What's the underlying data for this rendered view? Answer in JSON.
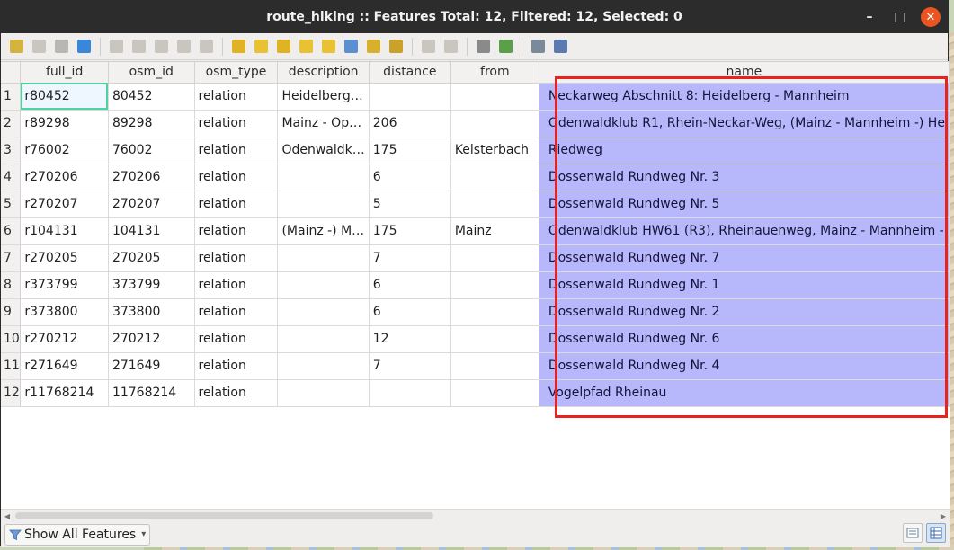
{
  "window": {
    "title": "route_hiking :: Features Total: 12, Filtered: 12, Selected: 0",
    "minimize_glyph": "–",
    "maximize_glyph": "□",
    "close_glyph": "✕"
  },
  "toolbar": {
    "icons": [
      {
        "name": "toggle-editing-icon",
        "color": "#d4b43c"
      },
      {
        "name": "multi-edit-icon",
        "color": "#c9c6bf"
      },
      {
        "name": "save-edits-icon",
        "color": "#b9b7b3"
      },
      {
        "name": "reload-icon",
        "color": "#3a86d8"
      },
      {
        "name": "add-feature-icon",
        "color": "#c9c6bf"
      },
      {
        "name": "delete-feature-icon",
        "color": "#c9c6bf"
      },
      {
        "name": "cut-icon",
        "color": "#c9c6bf"
      },
      {
        "name": "copy-icon",
        "color": "#c9c6bf"
      },
      {
        "name": "paste-icon",
        "color": "#c9c6bf"
      },
      {
        "name": "select-by-expression-icon",
        "color": "#e0b325"
      },
      {
        "name": "select-all-icon",
        "color": "#e8c233"
      },
      {
        "name": "invert-selection-icon",
        "color": "#e0b325"
      },
      {
        "name": "deselect-all-icon",
        "color": "#e8c233"
      },
      {
        "name": "filter-select-icon",
        "color": "#e8c233"
      },
      {
        "name": "move-selection-top-icon",
        "color": "#5a8fd0"
      },
      {
        "name": "pan-to-selected-icon",
        "color": "#d8b02c"
      },
      {
        "name": "zoom-to-selected-icon",
        "color": "#c9a22a"
      },
      {
        "name": "new-field-icon",
        "color": "#c9c6bf"
      },
      {
        "name": "delete-field-icon",
        "color": "#c9c6bf"
      },
      {
        "name": "field-calculator-icon",
        "color": "#8a8a8a"
      },
      {
        "name": "conditional-formatting-icon",
        "color": "#5aa04a"
      },
      {
        "name": "dock-table-icon",
        "color": "#7a8a9a"
      },
      {
        "name": "actions-icon",
        "color": "#5a7ab0"
      }
    ]
  },
  "table": {
    "columns": [
      "",
      "full_id",
      "osm_id",
      "osm_type",
      "description",
      "distance",
      "from",
      "name"
    ],
    "rows": [
      {
        "n": "1",
        "full_id": "r80452",
        "osm_id": "80452",
        "osm_type": "relation",
        "description": "Heidelberg…",
        "distance": "",
        "from": "",
        "name": "Neckarweg Abschnitt 8: Heidelberg - Mannheim"
      },
      {
        "n": "2",
        "full_id": "r89298",
        "osm_id": "89298",
        "osm_type": "relation",
        "description": "Mainz - Op…",
        "distance": "206",
        "from": "",
        "name": "Odenwaldklub R1, Rhein-Neckar-Weg, (Mainz - Mannheim -) He"
      },
      {
        "n": "3",
        "full_id": "r76002",
        "osm_id": "76002",
        "osm_type": "relation",
        "description": "Odenwaldk…",
        "distance": "175",
        "from": "Kelsterbach",
        "name": "Riedweg"
      },
      {
        "n": "4",
        "full_id": "r270206",
        "osm_id": "270206",
        "osm_type": "relation",
        "description": "",
        "distance": "6",
        "from": "",
        "name": "Dossenwald Rundweg Nr. 3"
      },
      {
        "n": "5",
        "full_id": "r270207",
        "osm_id": "270207",
        "osm_type": "relation",
        "description": "",
        "distance": "5",
        "from": "",
        "name": "Dossenwald Rundweg Nr. 5"
      },
      {
        "n": "6",
        "full_id": "r104131",
        "osm_id": "104131",
        "osm_type": "relation",
        "description": "(Mainz -) M…",
        "distance": "175",
        "from": "Mainz",
        "name": "Odenwaldklub HW61 (R3), Rheinauenweg, Mainz - Mannheim -"
      },
      {
        "n": "7",
        "full_id": "r270205",
        "osm_id": "270205",
        "osm_type": "relation",
        "description": "",
        "distance": "7",
        "from": "",
        "name": "Dossenwald Rundweg Nr. 7"
      },
      {
        "n": "8",
        "full_id": "r373799",
        "osm_id": "373799",
        "osm_type": "relation",
        "description": "",
        "distance": "6",
        "from": "",
        "name": "Dossenwald Rundweg Nr. 1"
      },
      {
        "n": "9",
        "full_id": "r373800",
        "osm_id": "373800",
        "osm_type": "relation",
        "description": "",
        "distance": "6",
        "from": "",
        "name": "Dossenwald Rundweg Nr. 2"
      },
      {
        "n": "10",
        "full_id": "r270212",
        "osm_id": "270212",
        "osm_type": "relation",
        "description": "",
        "distance": "12",
        "from": "",
        "name": "Dossenwald Rundweg Nr. 6"
      },
      {
        "n": "11",
        "full_id": "r271649",
        "osm_id": "271649",
        "osm_type": "relation",
        "description": "",
        "distance": "7",
        "from": "",
        "name": "Dossenwald Rundweg Nr. 4"
      },
      {
        "n": "12",
        "full_id": "r11768214",
        "osm_id": "11768214",
        "osm_type": "relation",
        "description": "",
        "distance": "",
        "from": "",
        "name": "Vogelpfad Rheinau"
      }
    ],
    "name_column_highlight_color": "#b7b8fb",
    "annotation_box_color": "#e8231d"
  },
  "statusbar": {
    "filter_button_label": "Show All Features",
    "filter_icon": "filter-funnel-icon",
    "view_form_icon": "form-view-icon",
    "view_table_icon": "table-view-icon"
  }
}
